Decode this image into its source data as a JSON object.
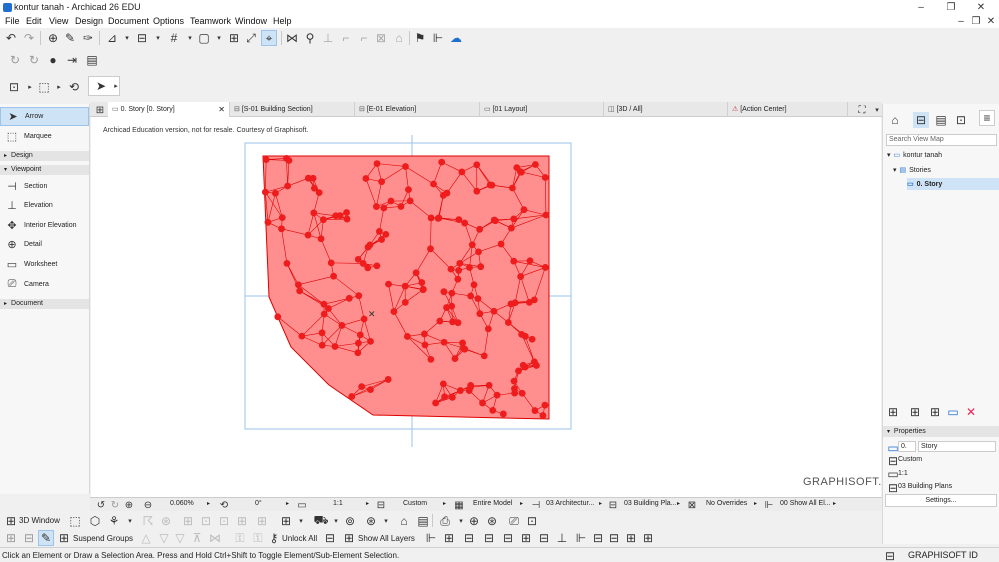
{
  "window": {
    "title": "kontur tanah - Archicad 26 EDU",
    "minimize": "–",
    "maximize": "❐",
    "close": "✕",
    "inner_minimize": "–",
    "inner_restore": "❐",
    "inner_close": "✕"
  },
  "menu": [
    "File",
    "Edit",
    "View",
    "Design",
    "Document",
    "Options",
    "Teamwork",
    "Window",
    "Help"
  ],
  "toolbox": {
    "tools": [
      {
        "label": "Arrow",
        "icon": "arrow-icon"
      },
      {
        "label": "Marquee",
        "icon": "marquee-icon"
      }
    ],
    "groups": {
      "design": "Design",
      "viewpoint": "Viewpoint",
      "document": "Document"
    },
    "viewpoint_tools": [
      {
        "label": "Section",
        "icon": "section-icon"
      },
      {
        "label": "Elevation",
        "icon": "elevation-icon"
      },
      {
        "label": "Interior Elevation",
        "icon": "interior-elevation-icon"
      },
      {
        "label": "Detail",
        "icon": "detail-icon"
      },
      {
        "label": "Worksheet",
        "icon": "worksheet-icon"
      },
      {
        "label": "Camera",
        "icon": "camera-icon"
      }
    ]
  },
  "tabs": [
    {
      "label": "0. Story [0. Story]",
      "active": true,
      "close": "✕"
    },
    {
      "label": "[S-01 Building Section]"
    },
    {
      "label": "[E-01 Elevation]"
    },
    {
      "label": "[01 Layout]"
    },
    {
      "label": "[3D / All]"
    },
    {
      "label": "[Action Center]"
    }
  ],
  "canvas": {
    "notice": "Archicad Education version, not for resale. Courtesy of Graphisoft.",
    "logo": "GRAPHISOFT."
  },
  "navigator": {
    "search_placeholder": "Search View Map",
    "tree": {
      "project": "kontur tanah",
      "stories": "Stories",
      "story": "0. Story"
    }
  },
  "properties": {
    "header": "Properties",
    "story_number": "0.",
    "story_name": "Story",
    "scale_type": "Custom",
    "scale": "1:1",
    "layer_set": "03 Building Plans",
    "settings_button": "Settings..."
  },
  "navbar": {
    "zoom": "0.060%",
    "angle": "0°",
    "scale": "1:1",
    "pen_set": "Custom",
    "model_view": "Entire Model",
    "layer_combo": "03 Architectur...",
    "layer_set": "03 Building Pla...",
    "overrides": "No Overrides",
    "renovation": "00 Show All El..."
  },
  "bottombar": {
    "window_3d": "3D Window",
    "suspend_groups": "Suspend Groups",
    "unlock_all": "Unlock All",
    "show_all_layers": "Show All Layers"
  },
  "status": {
    "message": "Click an Element or Draw a Selection Area. Press and Hold Ctrl+Shift to Toggle Element/Sub-Element Selection.",
    "graphisoft_id": "GRAPHISOFT ID"
  },
  "colors": {
    "mesh_fill": "#ff8080",
    "mesh_stroke": "#e00000",
    "selection_blue": "#9cc3ea"
  }
}
